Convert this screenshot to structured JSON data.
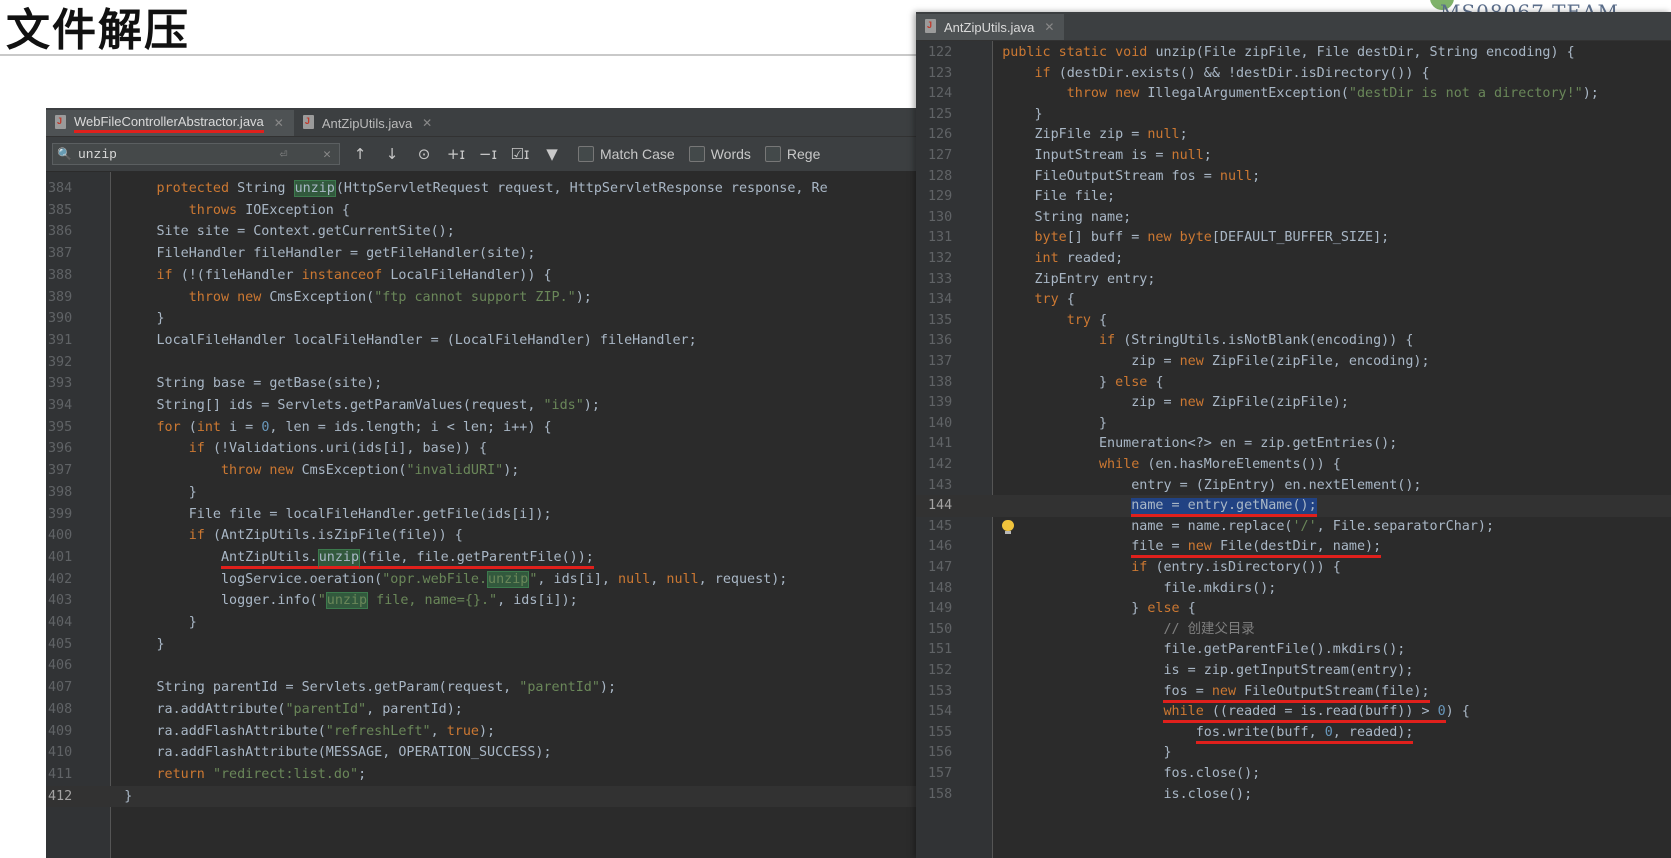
{
  "slide": {
    "title": "文件解压",
    "team_logo": "MS08067 TEAM"
  },
  "left": {
    "tabs": [
      {
        "label": "WebFileControllerAbstractor.java",
        "active": true
      },
      {
        "label": "AntZipUtils.java",
        "active": false
      }
    ],
    "search": {
      "value": "unzip",
      "match_case": "Match Case",
      "words": "Words",
      "regex": "Rege"
    },
    "lines": [
      {
        "n": "384",
        "t": [
          [
            "        ",
            ""
          ],
          [
            "protected ",
            "kw"
          ],
          [
            "String ",
            ""
          ],
          [
            "unzip",
            "hl"
          ],
          [
            "(HttpServletRequest request, HttpServletResponse response, Re",
            ""
          ]
        ]
      },
      {
        "n": "385",
        "t": [
          [
            "            ",
            ""
          ],
          [
            "throws ",
            "kw"
          ],
          [
            "IOException {",
            ""
          ]
        ]
      },
      {
        "n": "386",
        "t": [
          [
            "        Site site = Context.getCurrentSite();",
            ""
          ]
        ]
      },
      {
        "n": "387",
        "t": [
          [
            "        FileHandler fileHandler = getFileHandler(site);",
            ""
          ]
        ]
      },
      {
        "n": "388",
        "t": [
          [
            "        ",
            ""
          ],
          [
            "if ",
            "kw"
          ],
          [
            "(!(fileHandler ",
            ""
          ],
          [
            "instanceof ",
            "kw"
          ],
          [
            "LocalFileHandler)) {",
            ""
          ]
        ]
      },
      {
        "n": "389",
        "t": [
          [
            "            ",
            ""
          ],
          [
            "throw new ",
            "kw"
          ],
          [
            "CmsException(",
            ""
          ],
          [
            "\"ftp cannot support ZIP.\"",
            "str"
          ],
          [
            ");",
            ""
          ]
        ]
      },
      {
        "n": "390",
        "t": [
          [
            "        }",
            ""
          ]
        ]
      },
      {
        "n": "391",
        "t": [
          [
            "        LocalFileHandler localFileHandler = (LocalFileHandler) fileHandler;",
            ""
          ]
        ]
      },
      {
        "n": "392",
        "t": [
          [
            "",
            ""
          ]
        ]
      },
      {
        "n": "393",
        "t": [
          [
            "        String base = getBase(site);",
            ""
          ]
        ]
      },
      {
        "n": "394",
        "t": [
          [
            "        String[] ids = Servlets.getParamValues(request, ",
            ""
          ],
          [
            "\"ids\"",
            "str"
          ],
          [
            ");",
            ""
          ]
        ]
      },
      {
        "n": "395",
        "t": [
          [
            "        ",
            ""
          ],
          [
            "for ",
            "kw"
          ],
          [
            "(",
            ""
          ],
          [
            "int ",
            "kw"
          ],
          [
            "i = ",
            ""
          ],
          [
            "0",
            "num"
          ],
          [
            ", len = ids.length; i < len; i++) {",
            ""
          ]
        ]
      },
      {
        "n": "396",
        "t": [
          [
            "            ",
            ""
          ],
          [
            "if ",
            "kw"
          ],
          [
            "(!Validations.uri(ids[i], base)) {",
            ""
          ]
        ]
      },
      {
        "n": "397",
        "t": [
          [
            "                ",
            ""
          ],
          [
            "throw new ",
            "kw"
          ],
          [
            "CmsException(",
            ""
          ],
          [
            "\"invalidURI\"",
            "str"
          ],
          [
            ");",
            ""
          ]
        ]
      },
      {
        "n": "398",
        "t": [
          [
            "            }",
            ""
          ]
        ]
      },
      {
        "n": "399",
        "t": [
          [
            "            File file = localFileHandler.getFile(ids[i]);",
            ""
          ]
        ]
      },
      {
        "n": "400",
        "t": [
          [
            "            ",
            ""
          ],
          [
            "if ",
            "kw"
          ],
          [
            "(AntZipUtils.isZipFile(file)) {",
            ""
          ]
        ]
      },
      {
        "n": "401",
        "t": [
          [
            "                ",
            ""
          ],
          [
            "AntZipUtils.",
            "ul"
          ],
          [
            "unzip",
            "ul hl"
          ],
          [
            "(file, file.getParentFile());",
            "ul"
          ]
        ]
      },
      {
        "n": "402",
        "t": [
          [
            "                logService.oeration(",
            ""
          ],
          [
            "\"opr.webFile.",
            "str"
          ],
          [
            "unzip",
            "str hl"
          ],
          [
            "\"",
            "str"
          ],
          [
            ", ids[i], ",
            ""
          ],
          [
            "null",
            "kw"
          ],
          [
            ", ",
            ""
          ],
          [
            "null",
            "kw"
          ],
          [
            ", request);",
            ""
          ]
        ]
      },
      {
        "n": "403",
        "t": [
          [
            "                logger.info(",
            ""
          ],
          [
            "\"",
            "str"
          ],
          [
            "unzip",
            "str hl"
          ],
          [
            " file, name={}.\"",
            "str"
          ],
          [
            ", ids[i]);",
            ""
          ]
        ]
      },
      {
        "n": "404",
        "t": [
          [
            "            }",
            ""
          ]
        ]
      },
      {
        "n": "405",
        "t": [
          [
            "        }",
            ""
          ]
        ]
      },
      {
        "n": "406",
        "t": [
          [
            "",
            ""
          ]
        ]
      },
      {
        "n": "407",
        "t": [
          [
            "        String parentId = Servlets.getParam(request, ",
            ""
          ],
          [
            "\"parentId\"",
            "str"
          ],
          [
            ");",
            ""
          ]
        ]
      },
      {
        "n": "408",
        "t": [
          [
            "        ra.addAttribute(",
            ""
          ],
          [
            "\"parentId\"",
            "str"
          ],
          [
            ", parentId);",
            ""
          ]
        ]
      },
      {
        "n": "409",
        "t": [
          [
            "        ra.addFlashAttribute(",
            ""
          ],
          [
            "\"refreshLeft\"",
            "str"
          ],
          [
            ", ",
            ""
          ],
          [
            "true",
            "kw"
          ],
          [
            ");",
            ""
          ]
        ]
      },
      {
        "n": "410",
        "t": [
          [
            "        ra.addFlashAttribute(MESSAGE, OPERATION_SUCCESS);",
            ""
          ]
        ]
      },
      {
        "n": "411",
        "t": [
          [
            "        ",
            ""
          ],
          [
            "return ",
            "kw"
          ],
          [
            "\"redirect:list.do\"",
            "str"
          ],
          [
            ";",
            ""
          ]
        ]
      },
      {
        "n": "412",
        "t": [
          [
            "    }",
            ""
          ]
        ]
      }
    ]
  },
  "right": {
    "tabs": [
      {
        "label": "AntZipUtils.java",
        "active": true
      }
    ],
    "lines": [
      {
        "n": "122",
        "t": [
          [
            "    ",
            ""
          ],
          [
            "public static void ",
            "kw"
          ],
          [
            "unzip(File zipFile, File destDir, String encoding) {",
            ""
          ]
        ]
      },
      {
        "n": "123",
        "t": [
          [
            "        ",
            ""
          ],
          [
            "if ",
            "kw"
          ],
          [
            "(destDir.exists() && !destDir.isDirectory()) {",
            ""
          ]
        ]
      },
      {
        "n": "124",
        "t": [
          [
            "            ",
            ""
          ],
          [
            "throw new ",
            "kw"
          ],
          [
            "IllegalArgumentException(",
            ""
          ],
          [
            "\"destDir is not a directory!\"",
            "str"
          ],
          [
            ");",
            ""
          ]
        ]
      },
      {
        "n": "125",
        "t": [
          [
            "        }",
            ""
          ]
        ]
      },
      {
        "n": "126",
        "t": [
          [
            "        ZipFile zip = ",
            ""
          ],
          [
            "null",
            "kw"
          ],
          [
            ";",
            ""
          ]
        ]
      },
      {
        "n": "127",
        "t": [
          [
            "        InputStream is = ",
            ""
          ],
          [
            "null",
            "kw"
          ],
          [
            ";",
            ""
          ]
        ]
      },
      {
        "n": "128",
        "t": [
          [
            "        FileOutputStream fos = ",
            ""
          ],
          [
            "null",
            "kw"
          ],
          [
            ";",
            ""
          ]
        ]
      },
      {
        "n": "129",
        "t": [
          [
            "        File file;",
            ""
          ]
        ]
      },
      {
        "n": "130",
        "t": [
          [
            "        String name;",
            ""
          ]
        ]
      },
      {
        "n": "131",
        "t": [
          [
            "        ",
            ""
          ],
          [
            "byte",
            "kw"
          ],
          [
            "[] buff = ",
            ""
          ],
          [
            "new byte",
            "kw"
          ],
          [
            "[DEFAULT_BUFFER_SIZE];",
            ""
          ]
        ]
      },
      {
        "n": "132",
        "t": [
          [
            "        ",
            ""
          ],
          [
            "int ",
            "kw"
          ],
          [
            "readed;",
            ""
          ]
        ]
      },
      {
        "n": "133",
        "t": [
          [
            "        ZipEntry entry;",
            ""
          ]
        ]
      },
      {
        "n": "134",
        "t": [
          [
            "        ",
            ""
          ],
          [
            "try ",
            "kw"
          ],
          [
            "{",
            ""
          ]
        ]
      },
      {
        "n": "135",
        "t": [
          [
            "            ",
            ""
          ],
          [
            "try ",
            "kw"
          ],
          [
            "{",
            ""
          ]
        ]
      },
      {
        "n": "136",
        "t": [
          [
            "                ",
            ""
          ],
          [
            "if ",
            "kw"
          ],
          [
            "(StringUtils.isNotBlank(encoding)) {",
            ""
          ]
        ]
      },
      {
        "n": "137",
        "t": [
          [
            "                    zip = ",
            ""
          ],
          [
            "new ",
            "kw"
          ],
          [
            "ZipFile(zipFile, encoding);",
            ""
          ]
        ]
      },
      {
        "n": "138",
        "t": [
          [
            "                } ",
            ""
          ],
          [
            "else ",
            "kw"
          ],
          [
            "{",
            ""
          ]
        ]
      },
      {
        "n": "139",
        "t": [
          [
            "                    zip = ",
            ""
          ],
          [
            "new ",
            "kw"
          ],
          [
            "ZipFile(zipFile);",
            ""
          ]
        ]
      },
      {
        "n": "140",
        "t": [
          [
            "                }",
            ""
          ]
        ]
      },
      {
        "n": "141",
        "t": [
          [
            "                Enumeration<?> en = zip.getEntries();",
            ""
          ]
        ]
      },
      {
        "n": "142",
        "t": [
          [
            "                ",
            ""
          ],
          [
            "while ",
            "kw"
          ],
          [
            "(en.hasMoreElements()) {",
            ""
          ]
        ]
      },
      {
        "n": "143",
        "t": [
          [
            "                    entry = (ZipEntry) en.nextElement();",
            ""
          ]
        ]
      },
      {
        "n": "144",
        "t": [
          [
            "                    ",
            ""
          ],
          [
            "name = entry.getName();",
            "ul sel"
          ]
        ]
      },
      {
        "n": "145",
        "t": [
          [
            "                    name = name.replace(",
            ""
          ],
          [
            "'/'",
            "str"
          ],
          [
            ", File.separatorChar);",
            ""
          ]
        ]
      },
      {
        "n": "146",
        "t": [
          [
            "                    ",
            ""
          ],
          [
            "file = ",
            "ul"
          ],
          [
            "new ",
            "ul kw"
          ],
          [
            "File(destDir, name);",
            "ul"
          ]
        ]
      },
      {
        "n": "147",
        "t": [
          [
            "                    ",
            ""
          ],
          [
            "if ",
            "kw"
          ],
          [
            "(entry.isDirectory()) {",
            ""
          ]
        ]
      },
      {
        "n": "148",
        "t": [
          [
            "                        file.mkdirs();",
            ""
          ]
        ]
      },
      {
        "n": "149",
        "t": [
          [
            "                    } ",
            ""
          ],
          [
            "else ",
            "kw"
          ],
          [
            "{",
            ""
          ]
        ]
      },
      {
        "n": "150",
        "t": [
          [
            "                        ",
            ""
          ],
          [
            "// 创建父目录",
            "cmt"
          ]
        ]
      },
      {
        "n": "151",
        "t": [
          [
            "                        file.getParentFile().mkdirs();",
            ""
          ]
        ]
      },
      {
        "n": "152",
        "t": [
          [
            "                        is = zip.getInputStream(entry);",
            ""
          ]
        ]
      },
      {
        "n": "153",
        "t": [
          [
            "                        ",
            ""
          ],
          [
            "fos = ",
            "ul"
          ],
          [
            "new ",
            "ul kw"
          ],
          [
            "FileOutputStream(file);",
            "ul"
          ]
        ]
      },
      {
        "n": "154",
        "t": [
          [
            "                        ",
            ""
          ],
          [
            "while ",
            "ul kw"
          ],
          [
            "((readed = is.read(buff)) > ",
            "ul"
          ],
          [
            "0",
            "ul num"
          ],
          [
            ") {",
            ""
          ]
        ]
      },
      {
        "n": "155",
        "t": [
          [
            "                            ",
            ""
          ],
          [
            "fos.write(buff, ",
            "ul"
          ],
          [
            "0",
            "ul num"
          ],
          [
            ", readed);",
            "ul"
          ]
        ]
      },
      {
        "n": "156",
        "t": [
          [
            "                        }",
            ""
          ]
        ]
      },
      {
        "n": "157",
        "t": [
          [
            "                        fos.close();",
            ""
          ]
        ]
      },
      {
        "n": "158",
        "t": [
          [
            "                        is.close();",
            ""
          ]
        ]
      }
    ]
  }
}
